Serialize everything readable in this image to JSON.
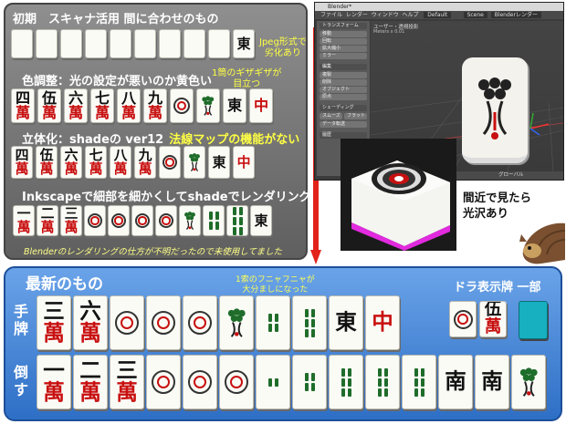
{
  "history": {
    "row1_title": "初期　スキャナ活用 間に合わせのもの",
    "row1_note": "Jpeg形式で\n劣化あり",
    "row2_title": "色調整：光の設定が悪いのか黄色い",
    "row2_note": "1筒のギザギザが\n目立つ",
    "row3_title_a": "立体化：shadeの ver12",
    "row3_title_b": "法線マップの機能がない",
    "row4_title": "Inkscapeで細部を細かくしてshadeでレンダリング",
    "footer": "Blenderのレンダリングの仕方が不明だったので未使用してました"
  },
  "blender": {
    "title": "Blender*",
    "menu": [
      "ファイル",
      "レンダー",
      "ウィンドウ",
      "ヘルプ",
      "Default",
      "Scene",
      "Blenderレンダー"
    ],
    "panel": [
      "トランスフォーム",
      "移動",
      "回転",
      "拡大縮小",
      "ミラー",
      "編集",
      "複製",
      "削除",
      "オブジェクト",
      "原点",
      "シェーディング",
      "スムーズ",
      "フラット",
      "データ転送",
      "履歴"
    ],
    "info": [
      "ユーザー・透視投影",
      "Meters x 0.01"
    ],
    "footer": "グローバル"
  },
  "closeup_caption": "間近で見たら\n光沢あり",
  "latest": {
    "title": "最新のもの",
    "arrow_note": "1索のフニャフニャが\n大分ましになった",
    "dora_label": "ドラ表示牌 一部",
    "hand_label": "手牌",
    "fallen_label": "倒す"
  },
  "tiles": {
    "row1": [
      "",
      "",
      "",
      "",
      "",
      "",
      "",
      "",
      "",
      "東"
    ],
    "row2": [
      [
        "四",
        "萬"
      ],
      [
        "伍",
        "萬"
      ],
      [
        "六",
        "萬"
      ],
      [
        "七",
        "萬"
      ],
      [
        "八",
        "萬"
      ],
      [
        "九",
        "萬"
      ],
      [
        "",
        ""
      ],
      [
        "",
        ""
      ],
      [
        "東",
        ""
      ],
      [
        "中",
        ""
      ]
    ],
    "row3": [
      [
        "四",
        "萬"
      ],
      [
        "伍",
        "萬"
      ],
      [
        "六",
        "萬"
      ],
      [
        "七",
        "萬"
      ],
      [
        "八",
        "萬"
      ],
      [
        "九",
        "萬"
      ],
      [
        "",
        ""
      ],
      [
        "",
        ""
      ],
      [
        "東",
        ""
      ],
      [
        "中",
        ""
      ]
    ],
    "row4": [
      [
        "一",
        "萬"
      ],
      [
        "二",
        "萬"
      ],
      [
        "三",
        "萬"
      ],
      [
        "",
        ""
      ],
      [
        "",
        ""
      ],
      [
        "",
        ""
      ],
      [
        "",
        ""
      ],
      [
        "",
        ""
      ],
      [
        "",
        ""
      ],
      [
        "",
        ""
      ],
      [
        "東",
        ""
      ]
    ],
    "hand": [
      [
        "三",
        "萬"
      ],
      [
        "六",
        "萬"
      ],
      [
        "",
        ""
      ],
      [
        "",
        ""
      ],
      [
        "",
        ""
      ],
      [
        "",
        ""
      ],
      [
        "",
        ""
      ],
      [
        "",
        ""
      ],
      [
        "東",
        ""
      ],
      [
        "中",
        ""
      ]
    ],
    "fallen": [
      [
        "一",
        "萬"
      ],
      [
        "二",
        "萬"
      ],
      [
        "三",
        "萬"
      ],
      [
        "",
        ""
      ],
      [
        "",
        ""
      ],
      [
        "",
        ""
      ],
      [
        "",
        ""
      ],
      [
        "",
        ""
      ],
      [
        "",
        ""
      ],
      [
        "",
        ""
      ],
      [
        "",
        ""
      ],
      [
        "南",
        ""
      ],
      [
        "南",
        ""
      ],
      [
        "",
        ""
      ]
    ],
    "dora": [
      [
        "",
        ""
      ],
      [
        "伍",
        "萬"
      ]
    ]
  }
}
